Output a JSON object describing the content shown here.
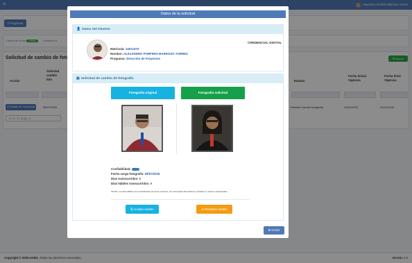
{
  "topbar": {
    "menu_icon": "hamburger-icon",
    "user_name": "Alejandro Porfirio Barroso Torres"
  },
  "background": {
    "return_label": "Regresar",
    "crumb_label": "Control de la fila",
    "crumb_pill": "Listado",
    "crumb_label2": "Solicitud ce",
    "page_title": "Solicitud de cambio de foto",
    "new_label": "Nuevo",
    "columns": {
      "accion": "Acción",
      "solicitud": "Solicitud cambio foto",
      "estatus": "Estatus",
      "inicial": "Fecha Inicial Vigencia",
      "final": "Fecha Final Vigencia"
    },
    "row": {
      "detail_label": "Detalle de Credencial",
      "date": "08/07/2025",
      "estatus": "Solicitud Cambio fotografía",
      "inicial": "19/02/2024",
      "final": "31/01/2025"
    },
    "pager": "1 - 1 / 1 (1)"
  },
  "modal": {
    "title": "Datos de la solicitud",
    "student_section": "Datos del Alumno",
    "matricula_label": "Matrícula:",
    "matricula": "24011570",
    "nombre_label": "Nombre:",
    "nombre": "ALEJANDRO PORFIRIO BARROSO TORRES",
    "programa_label": "Programa:",
    "programa": "Dirección de Proyectos",
    "credential": "CREDENCIAL DIGITAL",
    "photo_section": "Solicitud de cambio de fotografía",
    "original_label": "Fotografía original",
    "requested_label": "Fotografía solicitud",
    "confiabilidad_label": "Confiabilidad:",
    "confiabilidad": "86%",
    "fecha_carga_label": "Fecha carga fotografía:",
    "fecha_carga": "08/07/2025",
    "dias_trans_label": "Días transcurridos:",
    "dias_trans": "0",
    "dias_habiles_label": "Días hábiles transcurridos:",
    "dias_habiles": "0",
    "note": "*NOTA: Los días hábiles son considerados de lunes a viernes, sin contemplar días festivos o feriados ni recesos vacacionales.",
    "accept_label": "Aceptar cambio",
    "reject_label": "Rechazar cambio",
    "close_label": "Cerrar"
  },
  "footer": {
    "copyright_bold": "Copyright © 2025 UVEG.",
    "copyright_rest": " Todos los derechos reservados.",
    "version_label": "Versión",
    "version": "1.0"
  },
  "colors": {
    "primary": "#4f7ab8",
    "info": "#17a2d8",
    "success": "#16a04a",
    "warning": "#f39c12"
  }
}
